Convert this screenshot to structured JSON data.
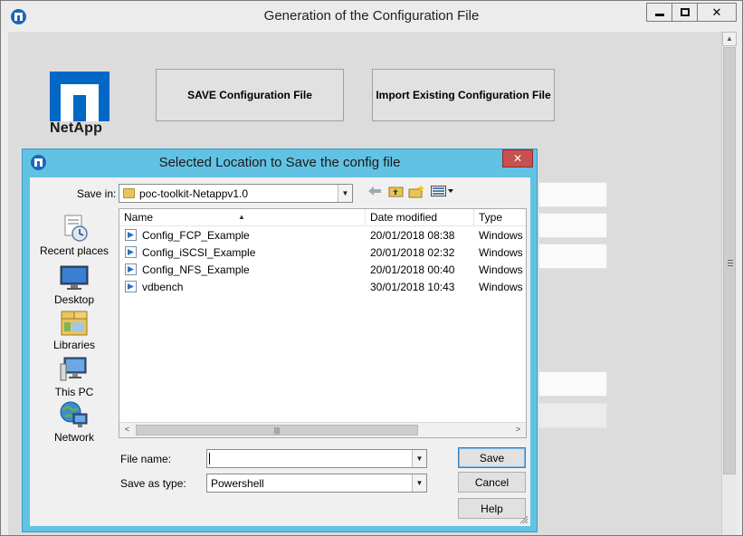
{
  "main_window": {
    "title": "Generation of the Configuration File",
    "minimize_glyph": "▬",
    "maximize_glyph": "□",
    "close_glyph": "✕",
    "logo_text": "NetApp",
    "save_button_label": "SAVE Configuration File",
    "import_button_label": "Import Existing Configuration File"
  },
  "dialog": {
    "title": "Selected Location to Save the config file",
    "close_glyph": "✕",
    "save_in_label": "Save in:",
    "save_in_value": "poc-toolkit-Netappv1.0",
    "places": [
      {
        "label": "Recent places",
        "icon": "recent-places-icon"
      },
      {
        "label": "Desktop",
        "icon": "desktop-icon"
      },
      {
        "label": "Libraries",
        "icon": "libraries-icon"
      },
      {
        "label": "This PC",
        "icon": "this-pc-icon"
      },
      {
        "label": "Network",
        "icon": "network-icon"
      }
    ],
    "columns": {
      "name": "Name",
      "date": "Date modified",
      "type": "Type"
    },
    "files": [
      {
        "name": "Config_FCP_Example",
        "date": "20/01/2018 08:38",
        "type": "Windows",
        "kind": "powershell"
      },
      {
        "name": "Config_iSCSI_Example",
        "date": "20/01/2018 02:32",
        "type": "Windows",
        "kind": "powershell"
      },
      {
        "name": "Config_NFS_Example",
        "date": "20/01/2018 00:40",
        "type": "Windows",
        "kind": "powershell"
      },
      {
        "name": "vdbench",
        "date": "30/01/2018 10:43",
        "type": "Windows",
        "kind": "powershell"
      }
    ],
    "file_name_label": "File name:",
    "file_name_value": "",
    "save_as_type_label": "Save as type:",
    "save_as_type_value": "Powershell",
    "save_button": "Save",
    "cancel_button": "Cancel",
    "help_button": "Help"
  },
  "colors": {
    "dialog_frame": "#62c2e3",
    "netapp_blue": "#0067c5",
    "close_red": "#c75050"
  }
}
